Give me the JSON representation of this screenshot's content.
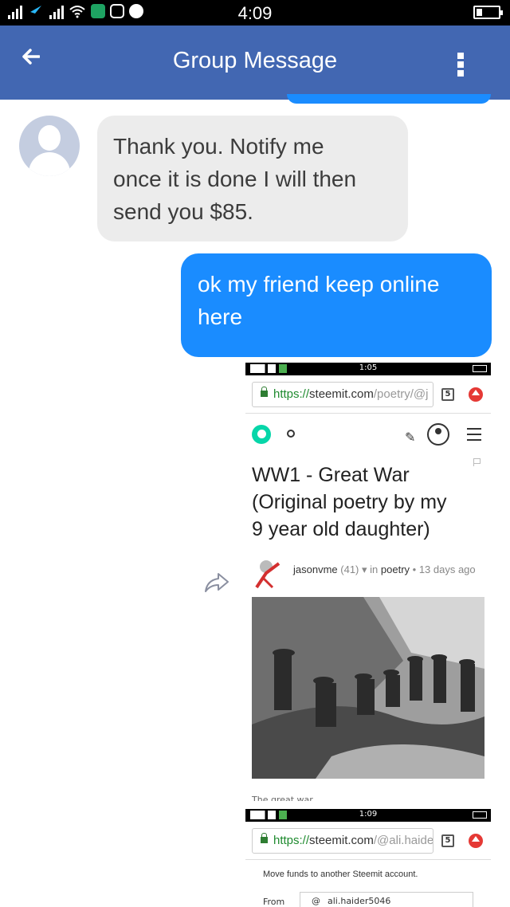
{
  "status_bar": {
    "time": "4:09"
  },
  "header": {
    "back_icon": "arrow-left-icon",
    "title": "Group Message",
    "menu_icon": "more-vertical-icon"
  },
  "messages": [
    {
      "direction": "incoming",
      "lines": [
        "Thank you. Notify me",
        "once it is done I will then",
        "send you $85."
      ]
    },
    {
      "direction": "outgoing",
      "lines": [
        "ok my friend keep online",
        "here"
      ]
    }
  ],
  "shared_image_1": {
    "status_time": "1:05",
    "url_scheme": "https://",
    "url_host": "steemit.com",
    "url_path": "/poetry/@j",
    "tab_count": "5",
    "post_title_lines": [
      "WW1 - Great War",
      "(Original poetry by my",
      "9 year old daughter)"
    ],
    "author": "jasonvme",
    "reputation": "(41)",
    "category_prefix": "in",
    "category": "poetry",
    "age": "13 days ago",
    "cutoff_text": "The great war"
  },
  "shared_image_2": {
    "status_time": "1:09",
    "url_scheme": "https://",
    "url_host": "steemit.com",
    "url_path": "/@ali.haide",
    "tab_count": "5",
    "transfer_text": "Move funds to another Steemit account.",
    "from_label": "From",
    "from_prefix": "@",
    "from_value": "ali.haider5046"
  },
  "colors": {
    "header": "#4267b2",
    "outgoing_bubble": "#1a8cff",
    "incoming_bubble": "#ececec"
  }
}
